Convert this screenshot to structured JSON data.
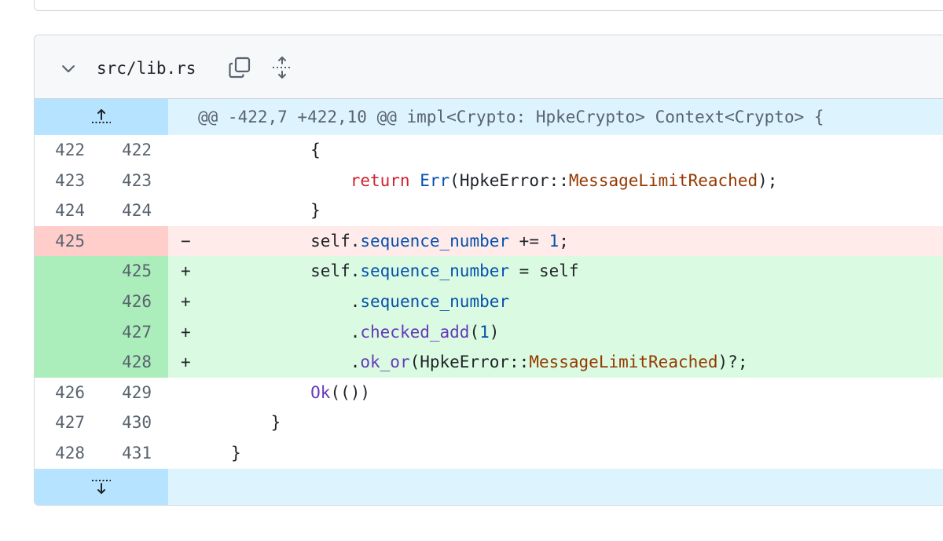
{
  "file": {
    "path": "src/lib.rs",
    "icons": {
      "collapse": "chevron-down-icon",
      "copy": "copy-icon",
      "expand_all": "unfold-icon"
    }
  },
  "hunk": {
    "header": "@@ -422,7 +422,10 @@ impl<Crypto: HpkeCrypto> Context<Crypto> {",
    "expand_up_icon": "expand-up-icon",
    "expand_down_icon": "expand-down-icon"
  },
  "lines": [
    {
      "type": "ctx",
      "old": "422",
      "new": "422",
      "marker": "",
      "indent": "        ",
      "segs": [
        {
          "t": "{",
          "c": "plain"
        }
      ]
    },
    {
      "type": "ctx",
      "old": "423",
      "new": "423",
      "marker": "",
      "indent": "            ",
      "segs": [
        {
          "t": "return",
          "c": "kw"
        },
        {
          "t": " ",
          "c": "plain"
        },
        {
          "t": "Err",
          "c": "ty"
        },
        {
          "t": "(HpkeError::",
          "c": "plain"
        },
        {
          "t": "MessageLimitReached",
          "c": "ty2"
        },
        {
          "t": ");",
          "c": "plain"
        }
      ]
    },
    {
      "type": "ctx",
      "old": "424",
      "new": "424",
      "marker": "",
      "indent": "        ",
      "segs": [
        {
          "t": "}",
          "c": "plain"
        }
      ]
    },
    {
      "type": "del",
      "old": "425",
      "new": "",
      "marker": "−",
      "indent": "        ",
      "segs": [
        {
          "t": "self.",
          "c": "plain"
        },
        {
          "t": "sequence_number",
          "c": "prop"
        },
        {
          "t": " += ",
          "c": "plain"
        },
        {
          "t": "1",
          "c": "num"
        },
        {
          "t": ";",
          "c": "plain"
        }
      ]
    },
    {
      "type": "add",
      "old": "",
      "new": "425",
      "marker": "+",
      "indent": "        ",
      "segs": [
        {
          "t": "self.",
          "c": "plain"
        },
        {
          "t": "sequence_number",
          "c": "prop"
        },
        {
          "t": " = self",
          "c": "plain"
        }
      ]
    },
    {
      "type": "add",
      "old": "",
      "new": "426",
      "marker": "+",
      "indent": "            ",
      "segs": [
        {
          "t": ".",
          "c": "plain"
        },
        {
          "t": "sequence_number",
          "c": "prop"
        }
      ]
    },
    {
      "type": "add",
      "old": "",
      "new": "427",
      "marker": "+",
      "indent": "            ",
      "segs": [
        {
          "t": ".",
          "c": "plain"
        },
        {
          "t": "checked_add",
          "c": "fn"
        },
        {
          "t": "(",
          "c": "plain"
        },
        {
          "t": "1",
          "c": "num"
        },
        {
          "t": ")",
          "c": "plain"
        }
      ]
    },
    {
      "type": "add",
      "old": "",
      "new": "428",
      "marker": "+",
      "indent": "            ",
      "segs": [
        {
          "t": ".",
          "c": "plain"
        },
        {
          "t": "ok_or",
          "c": "fn"
        },
        {
          "t": "(HpkeError::",
          "c": "plain"
        },
        {
          "t": "MessageLimitReached",
          "c": "ty2"
        },
        {
          "t": ")?;",
          "c": "plain"
        }
      ]
    },
    {
      "type": "ctx",
      "old": "426",
      "new": "429",
      "marker": "",
      "indent": "        ",
      "segs": [
        {
          "t": "Ok",
          "c": "fn"
        },
        {
          "t": "(())",
          "c": "plain"
        }
      ]
    },
    {
      "type": "ctx",
      "old": "427",
      "new": "430",
      "marker": "",
      "indent": "    ",
      "segs": [
        {
          "t": "}",
          "c": "plain"
        }
      ]
    },
    {
      "type": "ctx",
      "old": "428",
      "new": "431",
      "marker": "",
      "indent": "",
      "segs": [
        {
          "t": "}",
          "c": "plain"
        }
      ]
    }
  ]
}
